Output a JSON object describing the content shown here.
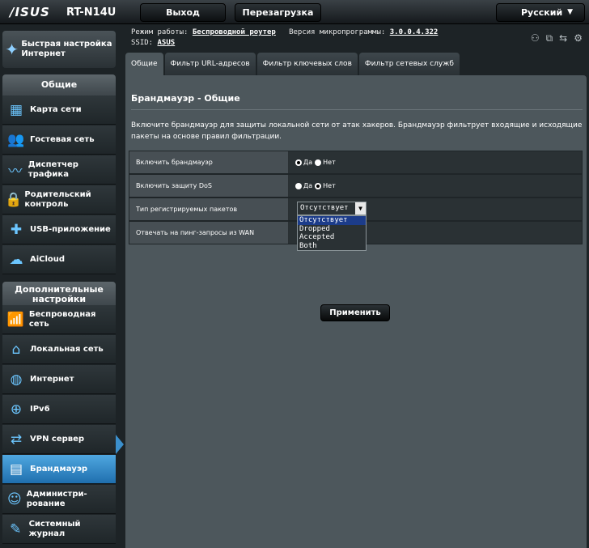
{
  "header": {
    "logo": "/ISUS",
    "model": "RT-N14U",
    "logout_label": "Выход",
    "reboot_label": "Перезагрузка",
    "language_label": "Русский"
  },
  "sidebar": {
    "quick_setup": "Быстрая настройка Интернет",
    "general_header": "Общие",
    "general_items": [
      {
        "label": "Карта сети",
        "icon": "network-map-icon"
      },
      {
        "label": "Гостевая сеть",
        "icon": "guest-network-icon"
      },
      {
        "label": "Диспетчер трафика",
        "icon": "traffic-manager-icon"
      },
      {
        "label": "Родительский контроль",
        "icon": "lock-icon"
      },
      {
        "label": "USB-приложение",
        "icon": "puzzle-icon"
      },
      {
        "label": "AiCloud",
        "icon": "cloud-icon"
      }
    ],
    "advanced_header": "Дополнительные настройки",
    "advanced_items": [
      {
        "label": "Беспроводная сеть",
        "icon": "wifi-icon"
      },
      {
        "label": "Локальная сеть",
        "icon": "home-icon"
      },
      {
        "label": "Интернет",
        "icon": "globe-icon"
      },
      {
        "label": "IPv6",
        "icon": "ipv6-icon"
      },
      {
        "label": "VPN сервер",
        "icon": "vpn-icon"
      },
      {
        "label": "Брандмауэр",
        "icon": "firewall-icon"
      },
      {
        "label": "Администри- рование",
        "icon": "admin-icon"
      },
      {
        "label": "Системный журнал",
        "icon": "syslog-icon"
      }
    ]
  },
  "status": {
    "mode_label": "Режим работы:",
    "mode_value": "Беспроводной роутер",
    "firmware_label": "Версия микропрограммы:",
    "firmware_value": "3.0.0.4.322",
    "ssid_label": "SSID:",
    "ssid_value": "ASUS"
  },
  "tabs": [
    "Общие",
    "Фильтр URL-адресов",
    "Фильтр ключевых слов",
    "Фильтр сетевых служб"
  ],
  "panel": {
    "title": "Брандмауэр - Общие",
    "description": "Включите брандмауэр для защиты локальной сети от атак хакеров. Брандмауэр фильтрует входящие и исходящие пакеты на основе правил фильтрации.",
    "rows": [
      {
        "label": "Включить брандмауэр"
      },
      {
        "label": "Включить защиту DoS"
      },
      {
        "label": "Тип регистрируемых пакетов"
      },
      {
        "label": "Отвечать на пинг-запросы из WAN"
      }
    ],
    "yes_label": "Да",
    "no_label": "Нет",
    "firewall_enabled": "Да",
    "dos_enabled": "Нет",
    "log_type_selected": "Отсутствует",
    "log_type_options": [
      "Отсутствует",
      "Dropped",
      "Accepted",
      "Both"
    ],
    "apply_label": "Применить"
  }
}
